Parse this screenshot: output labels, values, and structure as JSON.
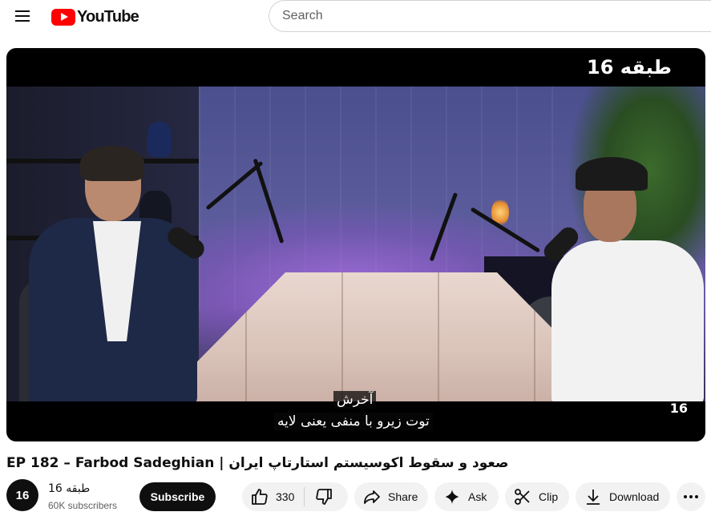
{
  "header": {
    "logo_text": "YouTube",
    "search_placeholder": "Search"
  },
  "player": {
    "brand_top": "طبقه 16",
    "brand_corner": "16",
    "captions": [
      "آخرش",
      "توت زیرو با منفی یعنی لایه"
    ]
  },
  "video": {
    "title": "EP 182 – Farbod Sadeghian | صعود و سقوط اکوسیستم استارتاپ ایران"
  },
  "channel": {
    "avatar_text": "16",
    "name": "طبقه 16",
    "subscribers": "60K subscribers",
    "subscribe_label": "Subscribe"
  },
  "actions": {
    "like_count": "330",
    "share_label": "Share",
    "ask_label": "Ask",
    "clip_label": "Clip",
    "download_label": "Download"
  },
  "colors": {
    "brand_red": "#ff0000",
    "text": "#0f0f0f",
    "secondary_text": "#606060",
    "pill_bg": "#f2f2f2"
  },
  "icons": [
    "menu-icon",
    "youtube-logo-icon",
    "thumbs-up-icon",
    "thumbs-down-icon",
    "share-icon",
    "sparkle-icon",
    "scissors-icon",
    "download-icon",
    "more-horizontal-icon"
  ]
}
